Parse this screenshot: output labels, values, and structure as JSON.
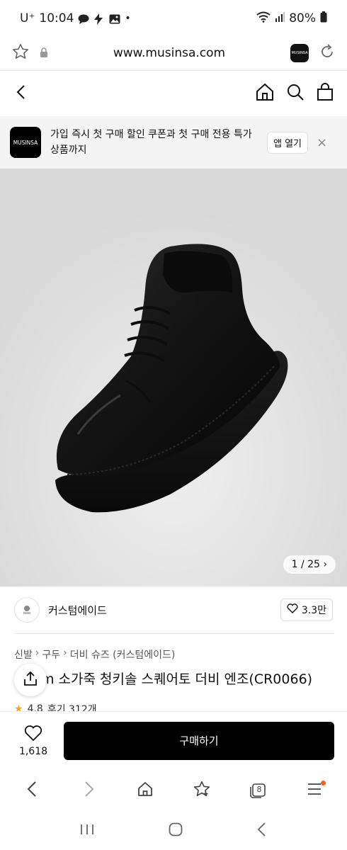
{
  "status_bar": {
    "carrier": "U⁺",
    "time": "10:04",
    "battery": "80%",
    "notification_icons": [
      "chat-icon",
      "bolt-icon",
      "image-icon"
    ],
    "dot": "•"
  },
  "browser": {
    "url": "www.musinsa.com",
    "tab_badge": "MUSINSA",
    "tab_count": "8"
  },
  "banner": {
    "logo_text": "MUSINSA",
    "message": "가입 즉시 첫 구매 할인 쿠폰과 첫 구매 전용 특가 상품까지",
    "open_app_label": "앱 열기",
    "close_label": "×"
  },
  "product_image": {
    "counter": "1 / 25"
  },
  "brand": {
    "name": "커스텀에이드",
    "likes": "3.3만"
  },
  "breadcrumb": [
    "신발",
    "구두",
    "더비 슈즈 (커스텀에이드)"
  ],
  "product": {
    "title": "m 소가죽 청키솔 스퀘어토 더비 엔조(CR0066)",
    "rating": "4.8",
    "reviews": "후기 312개"
  },
  "buy_bar": {
    "like_count": "1,618",
    "buy_label": "구매하기"
  },
  "colors": {
    "accent_black": "#000000",
    "notification_dot": "#ff5a1f",
    "banner_bg": "#f4f4f4"
  }
}
